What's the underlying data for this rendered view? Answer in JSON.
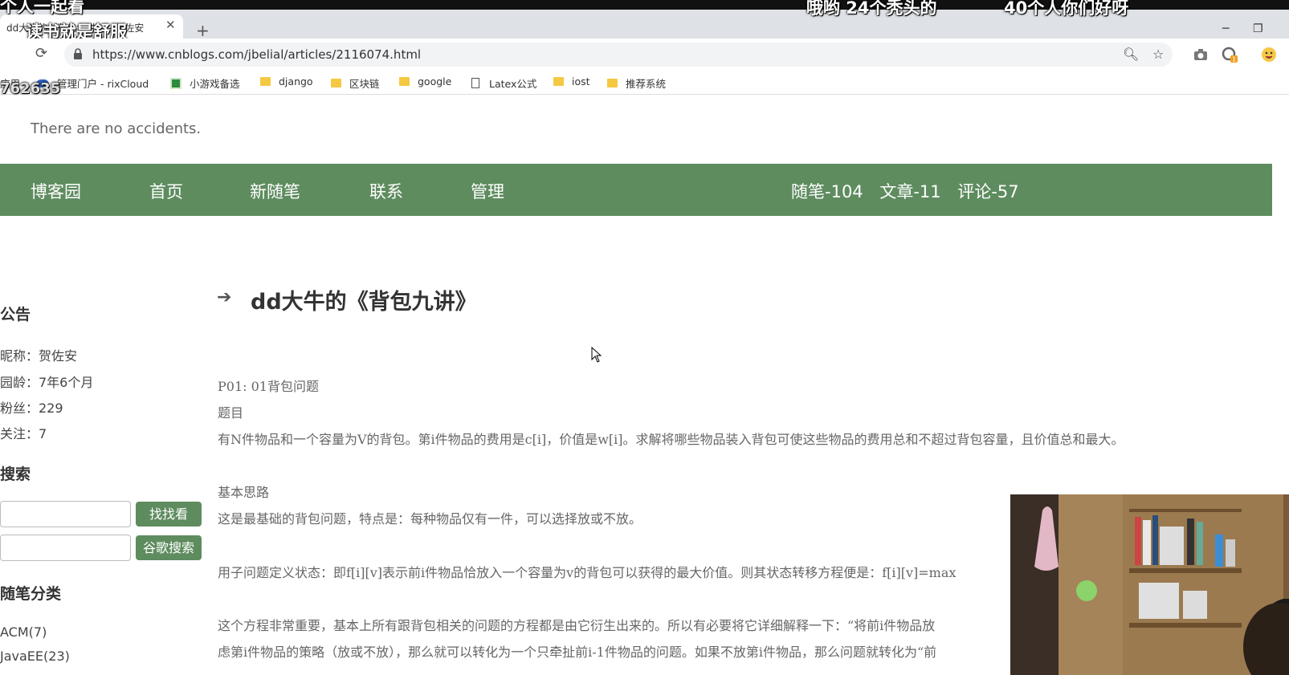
{
  "overlay": {
    "top_left": "个人一起看",
    "subtitle": "读书就是舒服",
    "top_mid": "哦哟 24个秃头的",
    "top_right": "40个人你们好呀",
    "counter_label": "762635"
  },
  "browser": {
    "tab_title": "dd大牛的《背包九讲》 - 贺佐安",
    "url": "https://www.cnblogs.com/jbelial/articles/2116074.html",
    "bookmarks": [
      {
        "label": "应用",
        "kind": "apps"
      },
      {
        "label": "管理门户 - rixCloud",
        "kind": "cloud"
      },
      {
        "label": "小游戏备选",
        "kind": "grid"
      },
      {
        "label": "django",
        "kind": "folder"
      },
      {
        "label": "区块链",
        "kind": "folder"
      },
      {
        "label": "google",
        "kind": "folder"
      },
      {
        "label": "Latex公式",
        "kind": "page"
      },
      {
        "label": "iost",
        "kind": "folder"
      },
      {
        "label": "推荐系统",
        "kind": "folder"
      }
    ],
    "extension_badge": "1"
  },
  "blog": {
    "tagline": "There are no accidents.",
    "nav": [
      "博客园",
      "首页",
      "新随笔",
      "联系",
      "管理"
    ],
    "stats": [
      "随笔-104",
      "文章-11",
      "评论-57"
    ]
  },
  "sidebar": {
    "announcement_heading": "公告",
    "info": [
      "昵称：贺佐安",
      "园龄：7年6个月",
      "粉丝：229",
      "关注：7"
    ],
    "search_heading": "搜索",
    "search_button": "找找看",
    "google_button": "谷歌搜索",
    "category_heading": "随笔分类",
    "categories": [
      "ACM(7)",
      "JavaEE(23)"
    ]
  },
  "article": {
    "title": "dd大牛的《背包九讲》",
    "paragraphs": [
      "P01: 01背包问题",
      "题目",
      "有N件物品和一个容量为V的背包。第i件物品的费用是c[i]，价值是w[i]。求解将哪些物品装入背包可使这些物品的费用总和不超过背包容量，且价值总和最大。",
      "基本思路",
      "这是最基础的背包问题，特点是：每种物品仅有一件，可以选择放或不放。",
      "用子问题定义状态：即f[i][v]表示前i件物品恰放入一个容量为v的背包可以获得的最大价值。则其状态转移方程便是：f[i][v]=max",
      "这个方程非常重要，基本上所有跟背包相关的问题的方程都是由它衍生出来的。所以有必要将它详细解释一下：“将前i件物品放",
      "虑第i件物品的策略（放或不放），那么就可以转化为一个只牵扯前i-1件物品的问题。如果不放第i件物品，那么问题就转化为“前"
    ]
  },
  "colors": {
    "nav_green": "#5e8c5f"
  }
}
